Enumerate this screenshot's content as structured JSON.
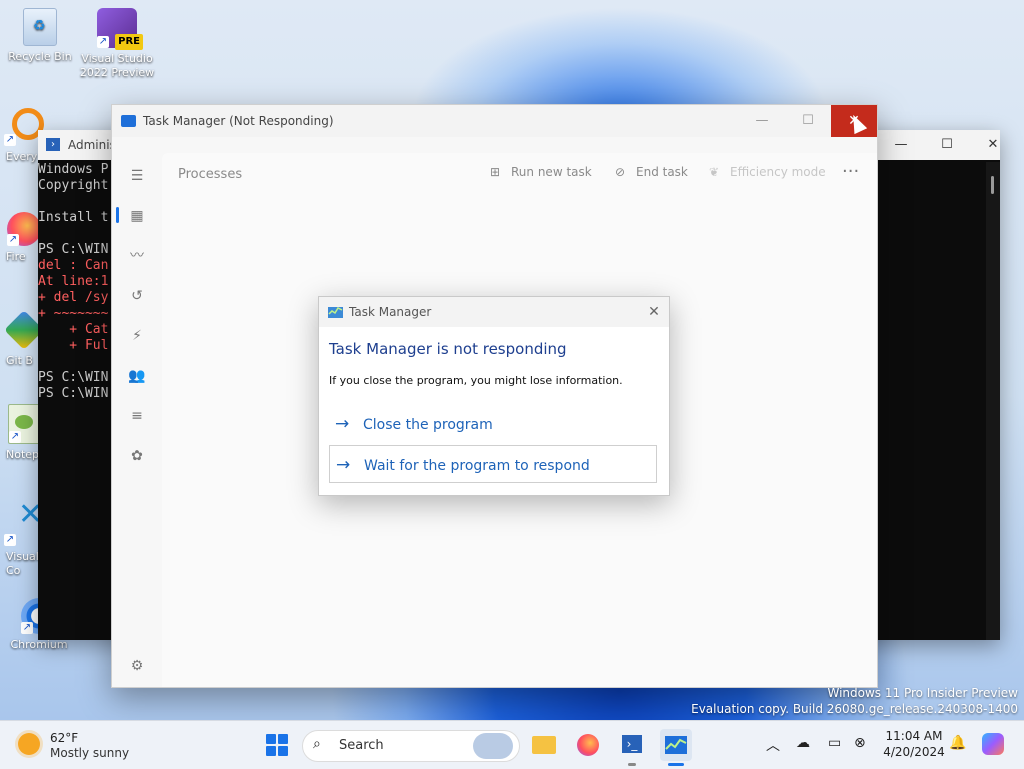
{
  "desktop": {
    "icons": [
      {
        "label": "Recycle Bin"
      },
      {
        "label": "Visual Studio 2022 Preview",
        "badge": "PRE"
      },
      {
        "label": "Every"
      },
      {
        "label": "Fire"
      },
      {
        "label": "Git B"
      },
      {
        "label": "Notep"
      },
      {
        "label": "Visual Co"
      },
      {
        "label": "Chromium"
      }
    ],
    "watermark_line1": "Windows 11 Pro Insider Preview",
    "watermark_line2": "Evaluation copy. Build 26080.ge_release.240308-1400"
  },
  "powershell": {
    "title": "Adminis",
    "lines": [
      {
        "text": "Windows P",
        "type": "normal"
      },
      {
        "text": "Copyright",
        "type": "normal"
      },
      {
        "text": "",
        "type": "normal"
      },
      {
        "text": "Install t",
        "type": "normal"
      },
      {
        "text": "",
        "type": "normal"
      },
      {
        "text": "PS C:\\WIN",
        "type": "normal"
      },
      {
        "text": "del : Can",
        "type": "err"
      },
      {
        "text": "At line:1",
        "type": "err"
      },
      {
        "text": "+ del /sy",
        "type": "err"
      },
      {
        "text": "+ ~~~~~~~",
        "type": "err"
      },
      {
        "text": "    + Cat",
        "type": "err"
      },
      {
        "text": "    + Ful",
        "type": "err"
      },
      {
        "text": "",
        "type": "normal"
      },
      {
        "text": "PS C:\\WIN",
        "type": "normal"
      },
      {
        "text": "PS C:\\WIN",
        "type": "normal"
      }
    ],
    "minimize": "—",
    "maximize": "☐",
    "close": "✕"
  },
  "task_manager": {
    "title": "Task Manager (Not Responding)",
    "minimize": "—",
    "maximize": "☐",
    "close": "✕",
    "heading": "Processes",
    "run_new_task": "Run new task",
    "end_task": "End task",
    "efficiency_mode": "Efficiency mode",
    "more": "···"
  },
  "dialog": {
    "title": "Task Manager",
    "heading": "Task Manager is not responding",
    "message": "If you close the program, you might lose information.",
    "option_close": "Close the program",
    "option_wait": "Wait for the program to respond",
    "arrow": "→",
    "close": "✕"
  },
  "taskbar": {
    "temperature": "62°F",
    "condition": "Mostly sunny",
    "search_placeholder": "Search",
    "time": "11:04 AM",
    "date": "4/20/2024"
  }
}
